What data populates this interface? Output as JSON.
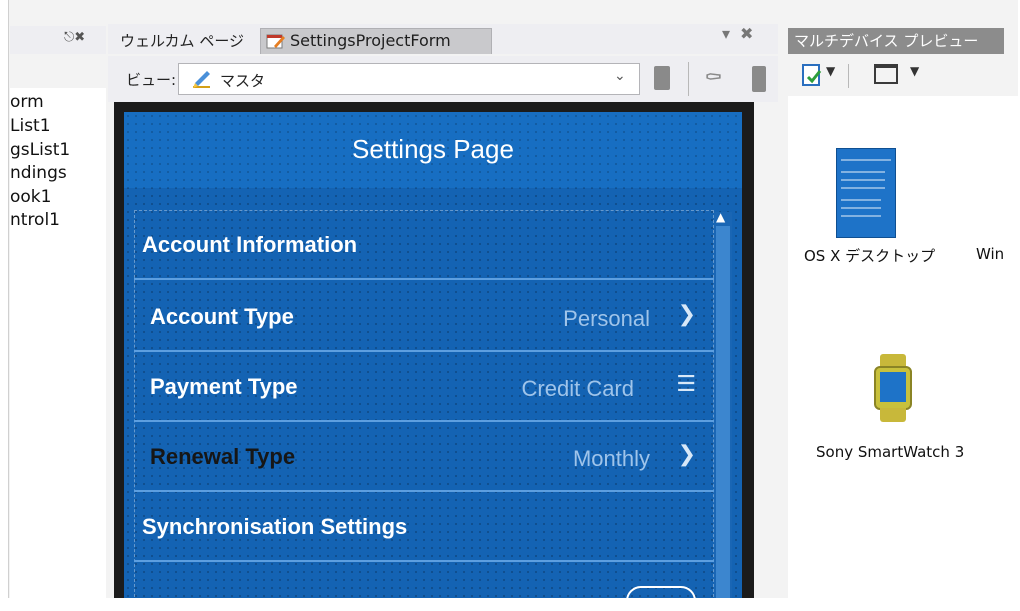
{
  "left_panel": {
    "items": [
      "orm",
      "List1",
      "gsList1",
      "ndings",
      "ook1",
      "ntrol1"
    ]
  },
  "tabs": {
    "welcome_label": "ウェルカム ページ",
    "active_label": "SettingsProjectForm"
  },
  "view_toolbar": {
    "label": "ビュー:",
    "selected_view": "マスタ"
  },
  "form": {
    "title": "Settings Page",
    "rows": [
      {
        "type": "group",
        "label": "Account Information"
      },
      {
        "type": "item",
        "label": "Account Type",
        "value": "Personal",
        "accessory": "chevron-right-icon"
      },
      {
        "type": "item",
        "label": "Payment Type",
        "value": "Credit Card",
        "accessory": "menu-lines-icon"
      },
      {
        "type": "item",
        "label": "Renewal Type",
        "value": "Monthly",
        "accessory": "chevron-right-icon"
      },
      {
        "type": "group",
        "label": "Synchronisation Settings"
      }
    ]
  },
  "preview": {
    "title": "マルチデバイス プレビュー",
    "devices": {
      "osx_label": "OS X デスクトップ",
      "win_label": "Win",
      "watch_label": "Sony SmartWatch 3"
    }
  },
  "colors": {
    "form_background": "#1463b3",
    "row_divider": "#5d9fe0",
    "device_bezel": "#1b1b1b"
  }
}
